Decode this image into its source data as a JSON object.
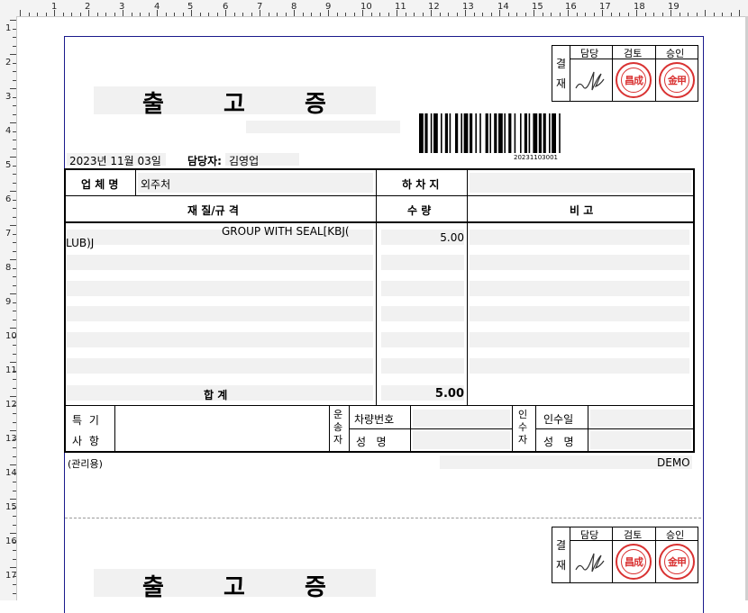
{
  "ruler": {
    "h_labels": [
      "1",
      "2",
      "3",
      "4",
      "5",
      "6",
      "7",
      "8",
      "9",
      "10",
      "11",
      "12",
      "13",
      "14",
      "15",
      "16",
      "17",
      "18",
      "19"
    ],
    "v_labels": [
      "1",
      "2",
      "3",
      "4",
      "5",
      "6",
      "7",
      "8",
      "9",
      "10",
      "11",
      "12",
      "13",
      "14",
      "15",
      "16",
      "17"
    ]
  },
  "doc": {
    "title": "출 고 증",
    "title_chars": [
      "출",
      "고",
      "증"
    ],
    "approval": {
      "side_label_1": "결",
      "side_label_2": "재",
      "headers": [
        "담당",
        "검토",
        "승인"
      ],
      "stamp_review": "昌成",
      "stamp_approve": "金甲"
    },
    "barcode_number": "20231103001",
    "date": "2023년 11월 03일",
    "manager_label": "담당자:",
    "manager_name": "김영업",
    "company_label": "업 체 명",
    "company_value": "외주처",
    "unload_label": "하 차 지",
    "unload_value": "",
    "col_spec": "재 질/규 격",
    "col_qty": "수 량",
    "col_note": "비 고",
    "items": [
      {
        "spec_line1": "GROUP WITH SEAL[KBJ(",
        "spec_line2": "LUB)J",
        "qty": "5.00",
        "note": ""
      }
    ],
    "total_label": "합  계",
    "total_qty": "5.00",
    "special_label_1": "특 기",
    "special_label_2": "사 항",
    "carrier_label": [
      "운",
      "송",
      "자"
    ],
    "vehicle_label": "차량번호",
    "carrier_name_label": "성   명",
    "receiver_label": [
      "인",
      "수",
      "자"
    ],
    "receive_date_label": "인수일",
    "receiver_name_label": "성   명",
    "admin_use": "(관리용)",
    "demo": "DEMO"
  }
}
